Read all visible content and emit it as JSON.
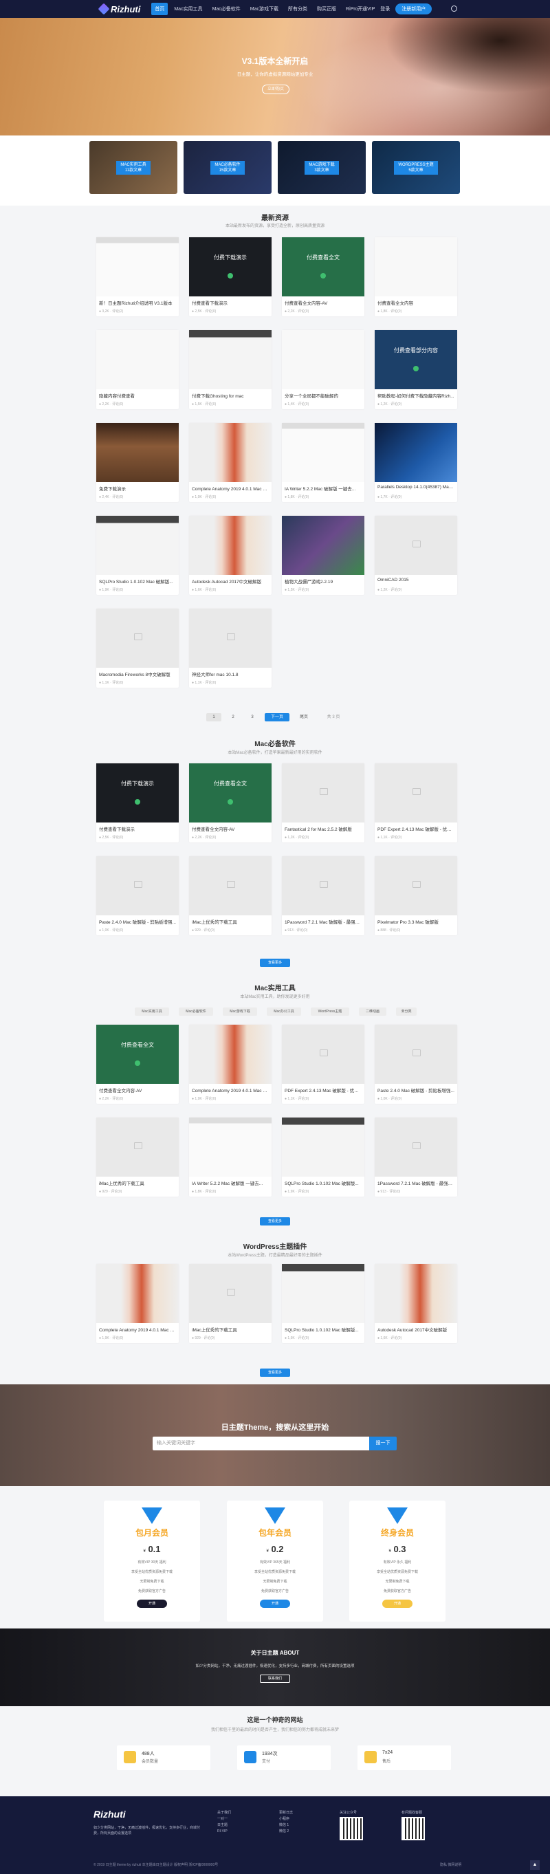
{
  "header": {
    "logo": "Rizhuti",
    "nav": [
      "首页",
      "Mac实用工具",
      "Mac必备软件",
      "Mac游戏下载",
      "所有分类",
      "购买正版",
      "RiPro"
    ],
    "vip": "开通VIP",
    "login": "登录",
    "register": "注册新用户"
  },
  "hero": {
    "title": "V3.1版本全新开启",
    "subtitle": "日主题，让你的虚拟资源网站更加专业",
    "button": "立即购买"
  },
  "categories": [
    {
      "label": "MAC实用工具",
      "count": "11款文章"
    },
    {
      "label": "MAC必备软件",
      "count": "15款文章"
    },
    {
      "label": "MAC游戏下载",
      "count": "3款文章"
    },
    {
      "label": "WORDPRESS主题",
      "count": "5款文章"
    }
  ],
  "latest": {
    "title": "最新资源",
    "subtitle": "本站最新发布的资源，享受打造全新，原创高质量资源",
    "items": [
      {
        "title": "新！日主题Rizhuti介绍说明 V3.1版本",
        "meta": "● 3,2K · 评论(2)",
        "thumb": "screen"
      },
      {
        "title": "付费查看下载演示",
        "meta": "● 2,5K · 评论(0)",
        "thumb": "dark",
        "pay": "付费下载演示"
      },
      {
        "title": "付费查看全文内容-AV",
        "meta": "● 2,2K · 评论(0)",
        "thumb": "green",
        "pay": "付费查看全文"
      },
      {
        "title": "付费查看全文内容",
        "meta": "● 1,8K · 评论(0)",
        "thumb": "white"
      },
      {
        "title": "隐藏内容付费查看",
        "meta": "● 2,2K · 评论(0)",
        "thumb": "white"
      },
      {
        "title": "付费下载Ghosting for mac",
        "meta": "● 1,5K · 评论(0)",
        "thumb": "ui"
      },
      {
        "title": "分享一个全局都不能破解的",
        "meta": "● 1,4K · 评论(0)",
        "thumb": "white"
      },
      {
        "title": "帮助教程-如何付费下载隐藏内容Rizh...",
        "meta": "● 1,2K · 评论(0)",
        "thumb": "blue",
        "pay": "付费查看部分内容"
      },
      {
        "title": "免费下载演示",
        "meta": "● 2,4K · 评论(0)",
        "thumb": "lib"
      },
      {
        "title": "Complete Anatomy 2019 4.0.1 Mac 破...",
        "meta": "● 1,9K · 评论(0)",
        "thumb": "skull"
      },
      {
        "title": "IA Writer 5.2.2 Mac 破解版 一键去...",
        "meta": "● 1,8K · 评论(0)",
        "thumb": "screen"
      },
      {
        "title": "Parallels Desktop 14.1.0(45387) Mac...",
        "meta": "● 1,7K · 评论(0)",
        "thumb": "win"
      },
      {
        "title": "SQLPro Studio 1.0.102 Mac 破解版...",
        "meta": "● 1,9K · 评论(0)",
        "thumb": "ui"
      },
      {
        "title": "Autodesk Autocad 2017中文破解版",
        "meta": "● 1,6K · 评论(0)",
        "thumb": "skull"
      },
      {
        "title": "植物大战僵尸游戏2.2.19",
        "meta": "● 1,5K · 评论(0)",
        "thumb": "game"
      },
      {
        "title": "OmniCAD 2015",
        "meta": "● 1,2K · 评论(0)",
        "thumb": "ph"
      },
      {
        "title": "Macromedia Fireworks 8中文破解版",
        "meta": "● 1,1K · 评论(0)",
        "thumb": "ph"
      },
      {
        "title": "神经大师for mac 10.1.8",
        "meta": "● 1,1K · 评论(0)",
        "thumb": "ph"
      }
    ]
  },
  "pager": {
    "p1": "1",
    "p2": "2",
    "p3": "3",
    "next": "下一页",
    "last": "尾页",
    "total": "共 3 页"
  },
  "sec2": {
    "title": "Mac必备软件",
    "subtitle": "本站Mac必备软件，打造苹果最新最好用的实用软件",
    "more": "查看更多",
    "items": [
      {
        "title": "付费查看下载演示",
        "meta": "● 2,5K · 评论(0)",
        "thumb": "dark",
        "pay": "付费下载演示"
      },
      {
        "title": "付费查看全文内容-AV",
        "meta": "● 2,2K · 评论(0)",
        "thumb": "green",
        "pay": "付费查看全文"
      },
      {
        "title": "Fantastical 2 for Mac 2.5.2 破解版",
        "meta": "● 1,2K · 评论(0)",
        "thumb": "ph"
      },
      {
        "title": "PDF Expert 2.4.13 Mac 破解版 - 优秀的...",
        "meta": "● 1,1K · 评论(0)",
        "thumb": "ph"
      },
      {
        "title": "Paste 2.4.0 Mac 破解版 - 剪贴板增强...",
        "meta": "● 1,0K · 评论(0)",
        "thumb": "ph"
      },
      {
        "title": "iMac上优秀的下载工具",
        "meta": "● 929 · 评论(0)",
        "thumb": "ph"
      },
      {
        "title": "1Password 7.2.1 Mac 破解版 - 最强大...",
        "meta": "● 913 · 评论(0)",
        "thumb": "ph"
      },
      {
        "title": "Pixelmator Pro 3.3 Mac 破解版",
        "meta": "● 888 · 评论(0)",
        "thumb": "ph"
      }
    ]
  },
  "sec3": {
    "title": "Mac实用工具",
    "subtitle": "本站Mac实用工具，助你发现更多好用",
    "tabs": [
      "Mac实用工具",
      "Mac必备软件",
      "Mac游戏下载",
      "Mac办公工具",
      "WordPress主题",
      "二维动画",
      "未分类"
    ],
    "more": "查看更多",
    "items": [
      {
        "title": "付费查看全文内容-AV",
        "meta": "● 2,2K · 评论(0)",
        "thumb": "green",
        "pay": "付费查看全文"
      },
      {
        "title": "Complete Anatomy 2019 4.0.1 Mac 破...",
        "meta": "● 1,9K · 评论(0)",
        "thumb": "skull"
      },
      {
        "title": "PDF Expert 2.4.13 Mac 破解版 - 优秀的...",
        "meta": "● 1,1K · 评论(0)",
        "thumb": "ph"
      },
      {
        "title": "Paste 2.4.0 Mac 破解版 - 剪贴板增强...",
        "meta": "● 1,0K · 评论(0)",
        "thumb": "ph"
      },
      {
        "title": "iMac上优秀的下载工具",
        "meta": "● 929 · 评论(0)",
        "thumb": "ph"
      },
      {
        "title": "IA Writer 5.2.2 Mac 破解版 一键去...",
        "meta": "● 1,8K · 评论(0)",
        "thumb": "screen"
      },
      {
        "title": "SQLPro Studio 1.0.102 Mac 破解版...",
        "meta": "● 1,9K · 评论(0)",
        "thumb": "ui"
      },
      {
        "title": "1Password 7.2.1 Mac 破解版 - 最强大...",
        "meta": "● 913 · 评论(0)",
        "thumb": "ph"
      }
    ]
  },
  "sec4": {
    "title": "WordPress主题插件",
    "subtitle": "本站WordPress主题，打造最精品最好用的主题插件",
    "more": "查看更多",
    "items": [
      {
        "title": "Complete Anatomy 2019 4.0.1 Mac 破...",
        "meta": "● 1,9K · 评论(0)",
        "thumb": "skull"
      },
      {
        "title": "iMac上优秀的下载工具",
        "meta": "● 929 · 评论(0)",
        "thumb": "ph"
      },
      {
        "title": "SQLPro Studio 1.0.102 Mac 破解版...",
        "meta": "● 1,9K · 评论(0)",
        "thumb": "ui"
      },
      {
        "title": "Autodesk Autocad 2017中文破解版",
        "meta": "● 1,6K · 评论(0)",
        "thumb": "skull"
      }
    ]
  },
  "search": {
    "title": "日主题Theme，搜索从这里开始",
    "placeholder": "输入关键词关键字",
    "button": "搜一下"
  },
  "vip": [
    {
      "name": "包月会员",
      "price": "0.1",
      "unit": "¥",
      "lines": [
        "有效VIP 30天 福利",
        "享受全站优质资源免费下载",
        "无限制免费下载",
        "免费获取官方广告"
      ],
      "button": "开通",
      "btncolor": "#1a1a2e"
    },
    {
      "name": "包年会员",
      "price": "0.2",
      "unit": "¥",
      "lines": [
        "有效VIP 365天 福利",
        "享受全站优质资源免费下载",
        "无限制免费下载",
        "免费获取官方广告"
      ],
      "button": "开通",
      "btncolor": "#1e88e5"
    },
    {
      "name": "终身会员",
      "price": "0.3",
      "unit": "¥",
      "lines": [
        "有效VIP 永久 福利",
        "享受全站优质资源免费下载",
        "无限制免费下载",
        "免费获取官方广告"
      ],
      "button": "开通",
      "btncolor": "#f5c542"
    }
  ],
  "about": {
    "title": "关于日主题 ABOUT",
    "text": "如少分类网站，干净，无痛过渡插件，极速优化，支持多行业，商城付费，所有页面的设置选项",
    "button": "联系我们"
  },
  "stats": {
    "title": "这是一个神奇的网站",
    "subtitle": "我们相信千里的最后的时间是否产生，我们相信的努力都将成就未来梦",
    "items": [
      {
        "num": "488人",
        "desc": "会员数量",
        "color": "#f5c542"
      },
      {
        "num": "1934次",
        "desc": "支付",
        "color": "#1e88e5"
      },
      {
        "num": "7x24",
        "desc": "售后",
        "color": "#f5c542"
      }
    ]
  },
  "footer": {
    "logo": "Rizhuti",
    "desc": "如少分类网站，干净，无痛过渡插件，极速优化，支持多行业，商城付费，所有页面的设置选项",
    "col1": [
      "关于我们",
      "一对一",
      "日主题",
      "RI-VIP"
    ],
    "col2": [
      "更新日志",
      "小程序",
      "微信 1",
      "微信 2"
    ],
    "qr1": "关注公众号",
    "qr2": "有问题找客服",
    "copyright": "© 2019 日主题 theme by rizhuti 本主题由日主题设计  版权声明  浙ICP备0000000号",
    "right": "隐私  微网说明"
  }
}
